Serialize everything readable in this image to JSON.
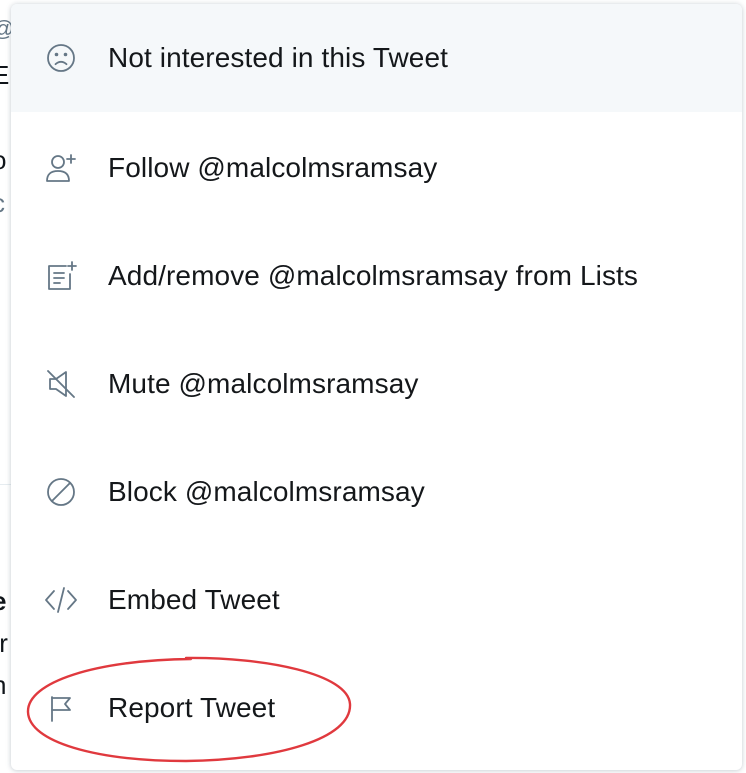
{
  "background": {
    "fragments": [
      "@",
      "E",
      "o",
      "c",
      "e",
      "fr",
      "h"
    ]
  },
  "menu": {
    "items": [
      {
        "label": "Not interested in this Tweet",
        "icon": "frown-face-icon"
      },
      {
        "label": "Follow @malcolmsramsay",
        "icon": "follow-user-icon"
      },
      {
        "label": "Add/remove @malcolmsramsay from Lists",
        "icon": "list-add-icon"
      },
      {
        "label": "Mute @malcolmsramsay",
        "icon": "mute-speaker-icon"
      },
      {
        "label": "Block @malcolmsramsay",
        "icon": "block-icon"
      },
      {
        "label": "Embed Tweet",
        "icon": "code-embed-icon"
      },
      {
        "label": "Report Tweet",
        "icon": "flag-icon"
      }
    ]
  },
  "colors": {
    "icon": "#657786",
    "text": "#14171a",
    "hover_bg": "#f5f8fa",
    "annotation": "#e0393e"
  }
}
